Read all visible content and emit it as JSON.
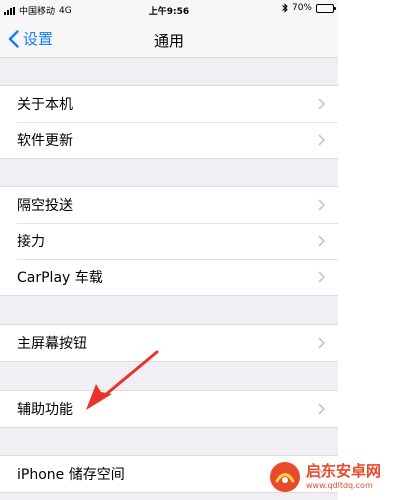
{
  "status_bar": {
    "carrier": "中国移动",
    "network": "4G",
    "time": "上午9:56",
    "battery_text": "70%",
    "battery_level": 0.7
  },
  "nav": {
    "back_label": "设置",
    "title": "通用"
  },
  "groups": [
    {
      "items": [
        "关于本机",
        "软件更新"
      ]
    },
    {
      "items": [
        "隔空投送",
        "接力",
        "CarPlay 车载"
      ]
    },
    {
      "items": [
        "主屏幕按钮"
      ]
    },
    {
      "items": [
        "辅助功能"
      ]
    },
    {
      "items": [
        "iPhone 储存空间"
      ]
    }
  ],
  "watermark": {
    "brand": "启东安卓网",
    "url": "www.qdltdq.com"
  },
  "colors": {
    "accent": "#1a7cf5",
    "annotation": "#e8322a",
    "watermark": "#e84a2c"
  }
}
